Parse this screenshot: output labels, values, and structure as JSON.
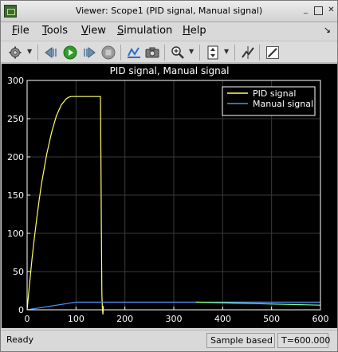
{
  "window": {
    "title": "Viewer: Scope1 (PID signal, Manual signal)",
    "minimize_glyph": "_",
    "maximize_glyph": "",
    "close_glyph": "✕"
  },
  "menubar": {
    "items": [
      {
        "accel": "F",
        "rest": "ile"
      },
      {
        "accel": "T",
        "rest": "ools"
      },
      {
        "accel": "V",
        "rest": "iew"
      },
      {
        "accel": "S",
        "rest": "imulation"
      },
      {
        "accel": "H",
        "rest": "elp"
      }
    ],
    "pin_glyph": "↘"
  },
  "toolbar": {
    "icons": [
      "gear-icon",
      "step-back-icon",
      "run-icon",
      "step-forward-icon",
      "stop-icon",
      "highlight-simulink-block-icon",
      "snapshot-icon",
      "zoom-in-icon",
      "scale-axes-icon",
      "cursor-measurements-icon",
      "edit-parameters-icon"
    ],
    "colors": {
      "run": "#2f9d2a",
      "stop": "#8e8e8e",
      "accent": "#2a6fc4"
    }
  },
  "plot": {
    "title": "PID signal, Manual signal",
    "background": "#000000",
    "axis_color": "#ffffff",
    "grid_color": "#3a3a3a",
    "legend_position": "top-right"
  },
  "chart_data": {
    "type": "line",
    "title": "PID signal, Manual signal",
    "xlabel": "",
    "ylabel": "",
    "xlim": [
      0,
      600
    ],
    "ylim": [
      0,
      300
    ],
    "xticks": [
      0,
      100,
      200,
      300,
      400,
      500,
      600
    ],
    "yticks": [
      0,
      50,
      100,
      150,
      200,
      250,
      300
    ],
    "grid": true,
    "legend": "top-right",
    "series": [
      {
        "name": "PID signal",
        "color": "#ffff66",
        "x": [
          0,
          5,
          10,
          15,
          20,
          25,
          30,
          40,
          50,
          60,
          70,
          80,
          85,
          90,
          95,
          100,
          150,
          151,
          152,
          153,
          154,
          155,
          156
        ],
        "y": [
          0,
          34,
          66,
          95,
          121,
          145,
          167,
          203,
          232,
          254,
          268,
          276,
          278,
          279,
          279,
          279,
          279,
          200,
          100,
          20,
          0,
          -6,
          5
        ]
      },
      {
        "name": "Manual signal",
        "color": "#4a90ff",
        "x": [
          0,
          100,
          155,
          340,
          600
        ],
        "y": [
          0,
          10,
          10,
          10,
          10
        ]
      },
      {
        "name": "",
        "color": "#88ff88",
        "x": [
          345,
          600
        ],
        "y": [
          10,
          6
        ]
      }
    ]
  },
  "statusbar": {
    "status": "Ready",
    "mode": "Sample based",
    "time": "T=600.000"
  }
}
